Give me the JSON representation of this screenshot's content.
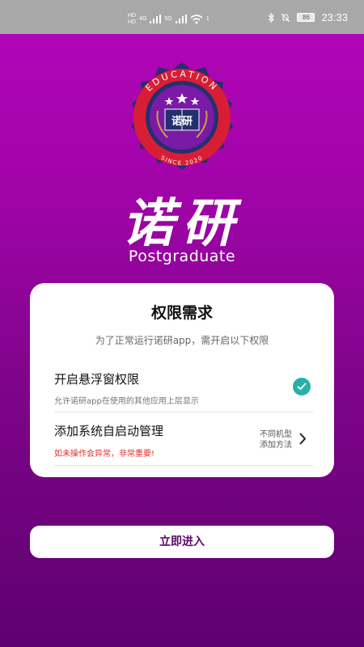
{
  "status_bar": {
    "hd1": "HD",
    "hd2": "HD",
    "net1": "4G",
    "net2": "5G",
    "wifi_badge": "1",
    "battery": "86",
    "time": "23:33"
  },
  "logo": {
    "arc_top": "EDUCATION",
    "arc_bottom": "SINCE 2020",
    "book_text": "诺研",
    "colors": {
      "outer": "#24306e",
      "ring": "#d81e35",
      "inner": "#7a1aa6"
    }
  },
  "brand": {
    "name_cn": "诺研",
    "name_en": "Postgraduate"
  },
  "permission_card": {
    "title": "权限需求",
    "subtitle": "为了正常运行诺研app，需开启以下权限",
    "items": [
      {
        "title": "开启悬浮窗权限",
        "desc": "允许诺研app在使用的其他应用上层显示",
        "status_icon": "check-circle-icon",
        "granted": true
      },
      {
        "title": "添加系统自启动管理",
        "warning": "如未操作会异常，非常重要!",
        "hint_line1": "不同机型",
        "hint_line2": "添加方法",
        "action_icon": "chevron-right-icon"
      }
    ]
  },
  "enter_button": {
    "label": "立即进入"
  },
  "accent_colors": {
    "check": "#27b0a6",
    "warning": "#e0312b",
    "button_text": "#5b0a6a"
  }
}
